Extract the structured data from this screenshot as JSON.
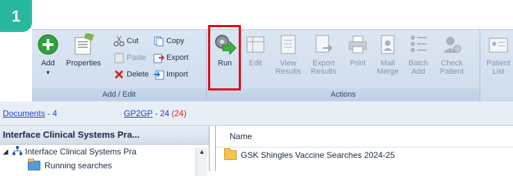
{
  "badge": "1",
  "ribbon": {
    "add_edit": {
      "label": "Add / Edit",
      "add": "Add",
      "properties": "Properties",
      "cut": "Cut",
      "copy": "Copy",
      "paste": "Paste",
      "export": "Export",
      "delete": "Delete",
      "import": "Import"
    },
    "actions": {
      "label": "Actions",
      "run": "Run",
      "edit": "Edit",
      "view_results_1": "View",
      "view_results_2": "Results",
      "export_results_1": "Export",
      "export_results_2": "Results",
      "print": "Print",
      "mail_merge_1": "Mail",
      "mail_merge_2": "Merge",
      "batch_add_1": "Batch",
      "batch_add_2": "Add",
      "check_patient_1": "Check",
      "check_patient_2": "Patient"
    },
    "patient_list_1": "Patient",
    "patient_list_2": "List"
  },
  "tabs": {
    "documents_label": "Documents",
    "documents_count": "- 4",
    "gp2gp_label": "GP2GP",
    "gp2gp_count": "- 24",
    "gp2gp_alert": "(24)"
  },
  "tree": {
    "header": "Interface Clinical Systems Pra...",
    "root": "Interface Clinical Systems Pra",
    "child": "Running searches"
  },
  "list": {
    "column_name": "Name",
    "rows": [
      "GSK Shingles Vaccine Searches 2024-25"
    ]
  },
  "colors": {
    "badge": "#28b8a0",
    "highlight": "#e5000a",
    "link": "#1b3ed1"
  }
}
